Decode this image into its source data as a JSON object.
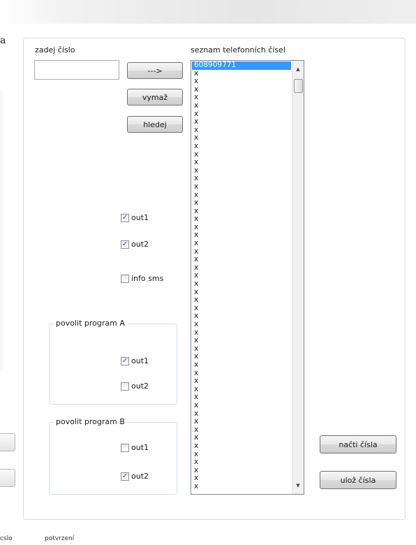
{
  "window": {
    "stray_char": "a"
  },
  "input": {
    "label": "zadej číslo",
    "value": ""
  },
  "buttons": {
    "add": "--->",
    "delete": "vymaž",
    "search": "hledej",
    "load": "načti čísla",
    "save": "ulož čísla"
  },
  "outputs": {
    "out1": {
      "label": "out1",
      "checked": true
    },
    "out2": {
      "label": "out2",
      "checked": true
    },
    "info_sms": {
      "label": "info sms",
      "checked": false
    }
  },
  "program_a": {
    "title": "povolit program A",
    "out1": {
      "label": "out1",
      "checked": true
    },
    "out2": {
      "label": "out2",
      "checked": false
    }
  },
  "program_b": {
    "title": "povolit program B",
    "out1": {
      "label": "out1",
      "checked": false
    },
    "out2": {
      "label": "out2",
      "checked": true
    }
  },
  "phone_list": {
    "label": "seznam telefonních čísel",
    "selected_index": 0,
    "items": [
      "608909771",
      "x",
      "x",
      "x",
      "x",
      "x",
      "x",
      "x",
      "x",
      "x",
      "x",
      "x",
      "x",
      "x",
      "x",
      "x",
      "x",
      "x",
      "x",
      "x",
      "x",
      "x",
      "x",
      "x",
      "x",
      "x",
      "x",
      "x",
      "x",
      "x",
      "x",
      "x",
      "x",
      "x",
      "x",
      "x",
      "x",
      "x",
      "x",
      "x",
      "x",
      "x",
      "x",
      "x",
      "x",
      "x",
      "x",
      "x",
      "x",
      "x",
      "x",
      "x",
      "x"
    ]
  },
  "status_bar": {
    "left": "cslo",
    "right": "potvrzení"
  }
}
